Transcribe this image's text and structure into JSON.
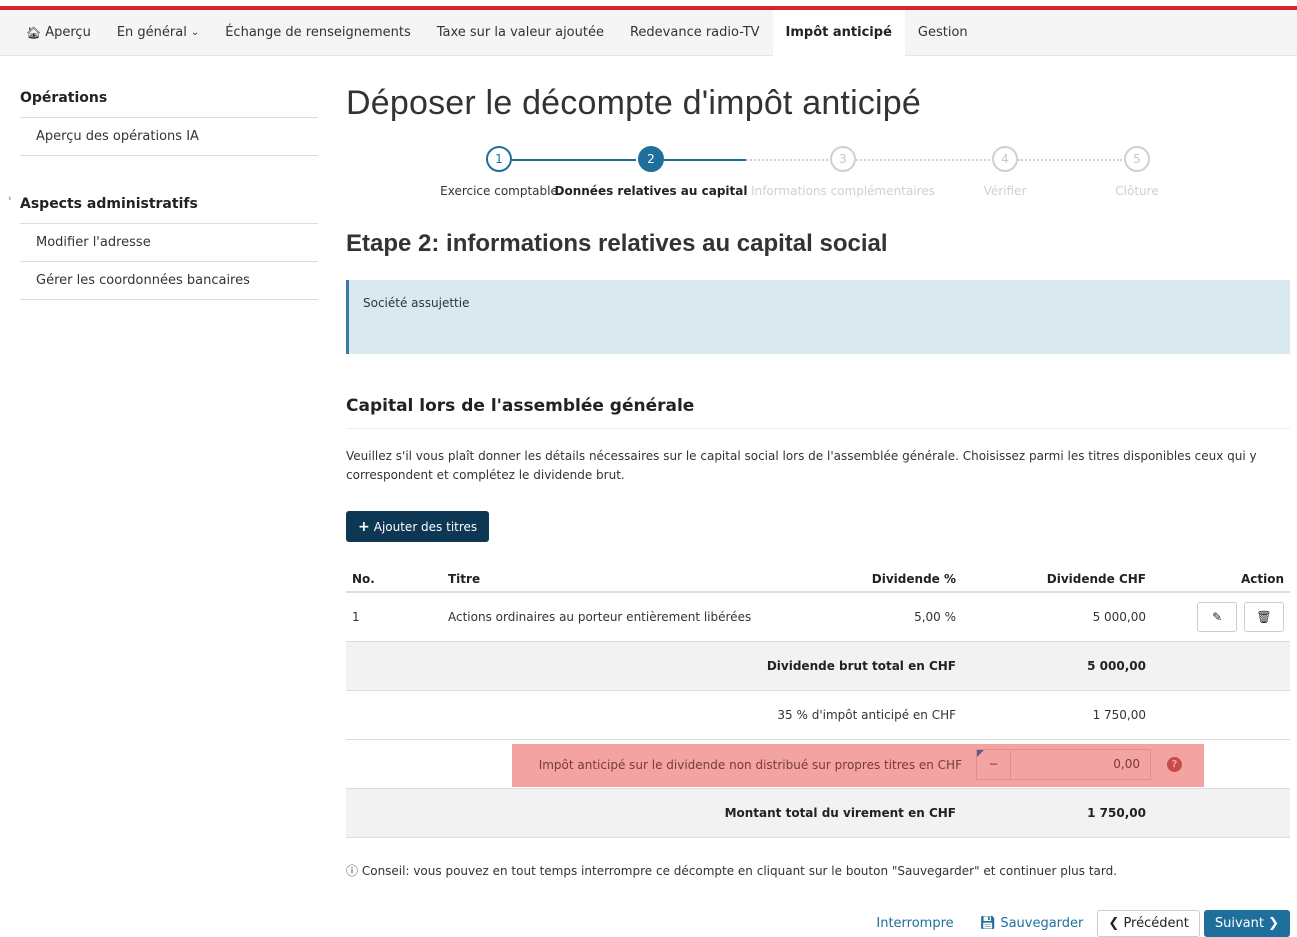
{
  "nav": {
    "items": [
      {
        "label": "Aperçu",
        "icon": "home-icon",
        "active": false
      },
      {
        "label": "En général",
        "dropdown": true,
        "active": false
      },
      {
        "label": "Échange de renseignements",
        "active": false
      },
      {
        "label": "Taxe sur la valeur ajoutée",
        "active": false
      },
      {
        "label": "Redevance radio-TV",
        "active": false
      },
      {
        "label": "Impôt anticipé",
        "active": true
      },
      {
        "label": "Gestion",
        "active": false
      }
    ]
  },
  "sidebar": {
    "sections": [
      {
        "heading": "Opérations",
        "items": [
          "Aperçu des opérations IA"
        ]
      },
      {
        "heading": "Aspects administratifs",
        "items": [
          "Modifier l'adresse",
          "Gérer les coordonnées bancaires"
        ]
      }
    ],
    "marker": "›"
  },
  "page": {
    "title": "Déposer le décompte d'impôt anticipé",
    "section_title": "Etape 2: informations relatives au capital social",
    "infobox": "Société assujettie",
    "subtitle": "Capital lors de l'assemblée générale",
    "description": "Veuillez s'il vous plaît donner les détails nécessaires sur le capital social lors de l'assemblée générale. Choisissez parmi les titres disponibles ceux qui y correspondent et complétez le dividende brut.",
    "add_button": "Ajouter des titres",
    "tip": "Conseil: vous pouvez en tout temps interrompre ce décompte en cliquant sur le bouton \"Sauvegarder\" et continuer plus tard."
  },
  "steps": [
    {
      "number": "1",
      "label": "Exercice comptable",
      "state": "done"
    },
    {
      "number": "2",
      "label": "Données relatives au capital",
      "state": "current"
    },
    {
      "number": "3",
      "label": "Informations complémentaires",
      "state": "todo"
    },
    {
      "number": "4",
      "label": "Vérifier",
      "state": "todo"
    },
    {
      "number": "5",
      "label": "Clôture",
      "state": "todo"
    }
  ],
  "table": {
    "headers": {
      "no": "No.",
      "title": "Titre",
      "div_pct": "Dividende %",
      "div_chf": "Dividende CHF",
      "action": "Action"
    },
    "rows": [
      {
        "no": "1",
        "title": "Actions ordinaires au porteur entièrement libérées",
        "div_pct": "5,00 %",
        "div_chf": "5 000,00"
      }
    ],
    "gross_total_label": "Dividende brut total en CHF",
    "gross_total_value": "5 000,00",
    "tax_label": "35 % d'impôt anticipé en CHF",
    "tax_value": "1 750,00",
    "own_label": "Impôt anticipé sur le dividende non distribué sur propres titres en CHF",
    "own_sign": "−",
    "own_value": "0,00",
    "transfer_label": "Montant total du virement en CHF",
    "transfer_value": "1 750,00"
  },
  "footer": {
    "interrupt": "Interrompre",
    "save": "Sauvegarder",
    "previous": "Précédent",
    "next": "Suivant"
  },
  "colors": {
    "brand_red": "#d8232a",
    "primary_blue": "#1f6f9d",
    "dark_button": "#0e3754",
    "highlight": "#f4a3a3",
    "infobox_bg": "#d9e9ef"
  }
}
